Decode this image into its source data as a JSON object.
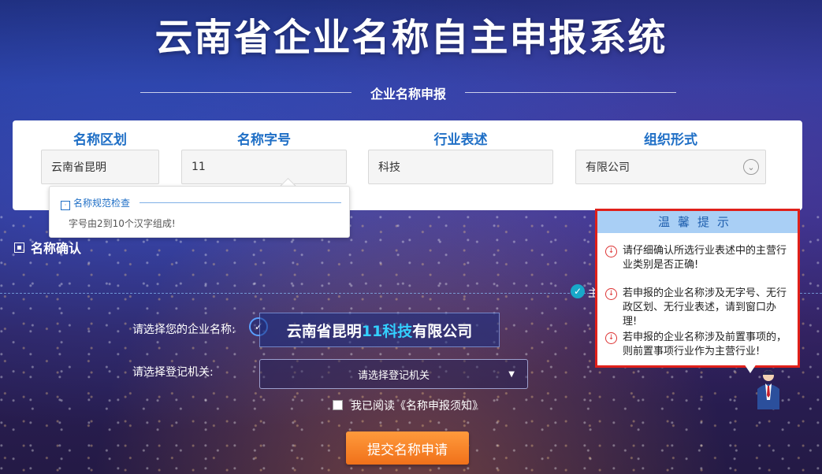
{
  "page": {
    "title": "云南省企业名称自主申报系统",
    "subtitle": "企业名称申报"
  },
  "fields": [
    {
      "label": "名称区划",
      "value": "云南省昆明"
    },
    {
      "label": "名称字号",
      "value": "11"
    },
    {
      "label": "行业表述",
      "value": "科技"
    },
    {
      "label": "组织形式",
      "value": "有限公司"
    }
  ],
  "tooltip": {
    "title": "名称规范检查",
    "message": "字号由2到10个汉字组成!"
  },
  "confirm": {
    "section_title": "名称确认",
    "partial_text": "主",
    "company_label": "请选择您的企业名称:",
    "company_prefix": "云南省昆明",
    "company_highlight": "11科技",
    "company_suffix": "有限公司",
    "authority_label": "请选择登记机关:",
    "authority_placeholder": "请选择登记机关",
    "agree_text": "我已阅读《名称申报须知》",
    "submit_label": "提交名称申请"
  },
  "warm_tips": {
    "title": "温馨提示",
    "items": [
      "请仔细确认所选行业表述中的主营行业类别是否正确!",
      "若申报的企业名称涉及无字号、无行政区划、无行业表述，请到窗口办理!",
      "若申报的企业名称涉及前置事项的，则前置事项行业作为主营行业!"
    ]
  },
  "icons": {
    "chevron": "chevron-down-icon",
    "check": "check-circle-icon",
    "warning": "warning-icon"
  },
  "colors": {
    "accent_blue": "#1f6fc6",
    "submit_orange": "#f0711a",
    "highlight_cyan": "#33d0ff",
    "alert_red": "#e0201a"
  }
}
